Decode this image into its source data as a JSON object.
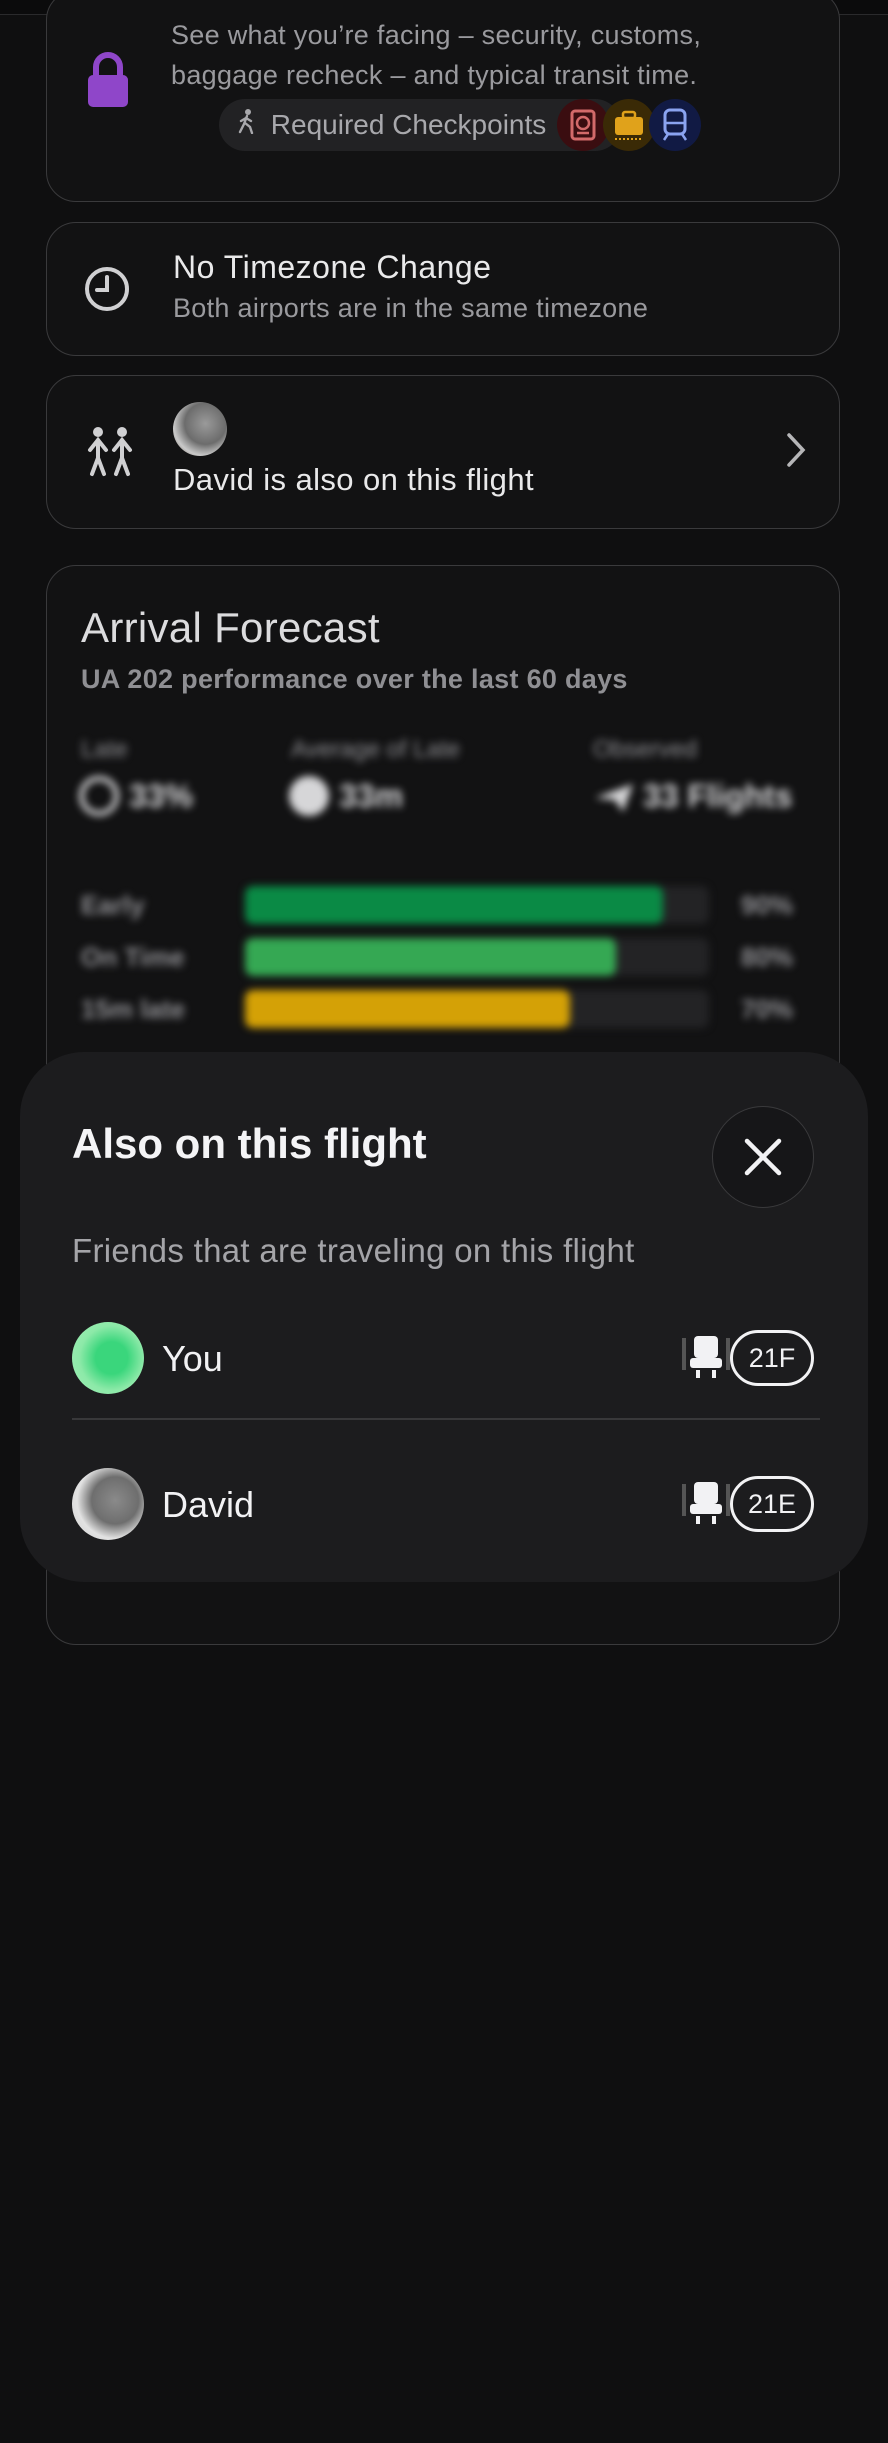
{
  "checkpoints_card": {
    "description": "See what you’re facing – security, customs, baggage recheck – and typical transit time.",
    "chip_label": "Required Checkpoints →"
  },
  "timezone_card": {
    "title": "No Timezone Change",
    "subtitle": "Both airports are in the same timezone"
  },
  "friends_card": {
    "text": "David is also on this flight"
  },
  "forecast": {
    "title": "Arrival Forecast",
    "subtitle": "UA 202 performance over the last 60 days",
    "stats": [
      {
        "label": "Late",
        "value": "33%"
      },
      {
        "label": "Average of Late",
        "value": "33m"
      },
      {
        "label": "Observed",
        "value": "33 Flights"
      }
    ],
    "bars": [
      {
        "label": "Early",
        "pct_label": "90%",
        "value": 0.9,
        "color": "#0a8a45"
      },
      {
        "label": "On Time",
        "pct_label": "80%",
        "value": 0.8,
        "color": "#35a853"
      },
      {
        "label": "15m late",
        "pct_label": "70%",
        "value": 0.7,
        "color": "#d4a106"
      }
    ]
  },
  "sheet": {
    "title": "Also on this flight",
    "subtitle": "Friends that are traveling on this flight",
    "passengers": [
      {
        "name": "You",
        "seat": "21F"
      },
      {
        "name": "David",
        "seat": "21E"
      }
    ]
  },
  "colors": {
    "lock": "#8f46c9",
    "passport_badge": "#3a0d10",
    "baggage_badge": "#3a2a06",
    "train_badge": "#111a44",
    "you_avatar": "#7ee6a0"
  },
  "icons": [
    "lock-icon",
    "walking-icon",
    "passport-icon",
    "baggage-icon",
    "train-icon",
    "clock-icon",
    "people-icon",
    "chevron-right-icon",
    "late-icon",
    "timer-icon",
    "plane-icon",
    "close-icon",
    "seat-icon"
  ]
}
